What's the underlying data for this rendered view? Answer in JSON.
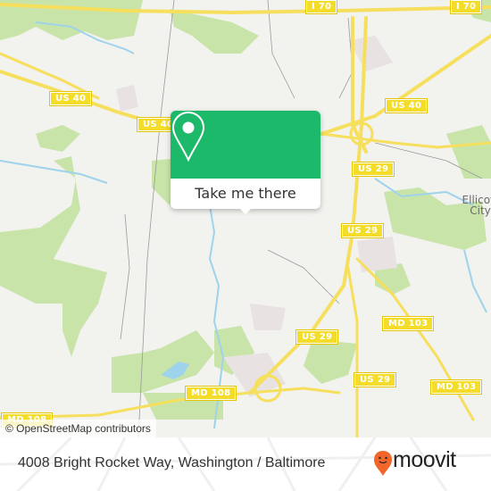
{
  "map": {
    "road_shields": [
      {
        "label": "I 70"
      },
      {
        "label": "I 70"
      },
      {
        "label": "US 40"
      },
      {
        "label": "US 40"
      },
      {
        "label": "US 40"
      },
      {
        "label": "US 29"
      },
      {
        "label": "US 29"
      },
      {
        "label": "US 29"
      },
      {
        "label": "US 29"
      },
      {
        "label": "MD 103"
      },
      {
        "label": "MD 103"
      },
      {
        "label": "MD 108"
      },
      {
        "label": "MD 108"
      }
    ],
    "places": [
      {
        "label": "Ellicott City"
      }
    ],
    "attribution": "© OpenStreetMap contributors",
    "colors": {
      "land": "#f2f2ef",
      "park": "#c9e4a8",
      "water": "#9fd3ec",
      "road_major": "#f6df5c",
      "road_minor": "#9a9a9a"
    }
  },
  "popup": {
    "pin_icon": "map-pin-icon",
    "button_label": "Take me there",
    "accent": "#1db96b"
  },
  "footer": {
    "address": "4008 Bright Rocket Way, Washington / Baltimore",
    "brand": "moovit",
    "brand_color": "#f2662c"
  }
}
